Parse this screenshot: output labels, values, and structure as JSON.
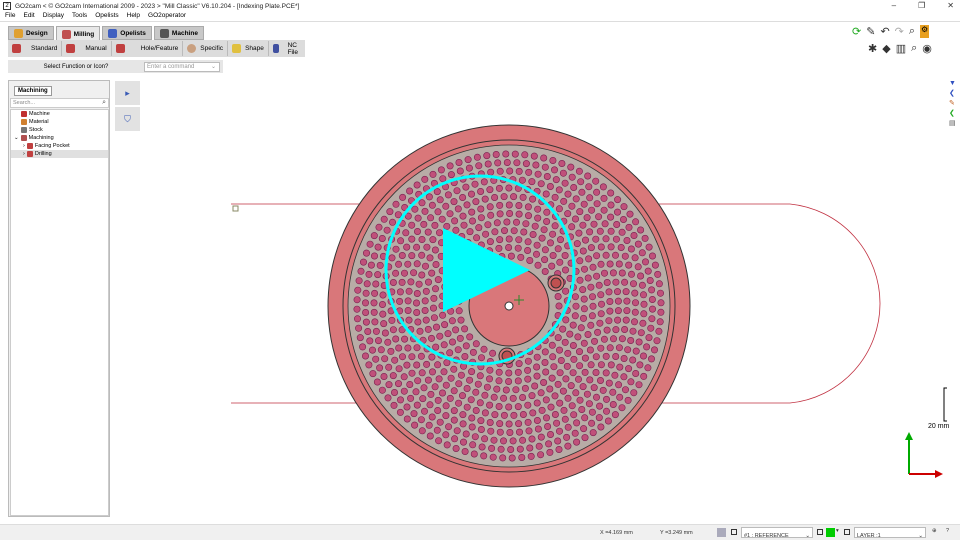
{
  "title": "GO2cam < © GO2cam International 2009 - 2023 >     \"Mill Classic\"   V6.10.204 - [Indexing Plate.PCE*]",
  "window_controls": [
    "–",
    "❐",
    "✕"
  ],
  "menu": [
    "File",
    "Edit",
    "Display",
    "Tools",
    "Opelists",
    "Help",
    "GO2operator"
  ],
  "tabs": [
    {
      "label": "Design",
      "color": "#e0a030"
    },
    {
      "label": "Milling",
      "color": "#c05050",
      "active": true
    },
    {
      "label": "Opelists",
      "color": "#4060c0"
    },
    {
      "label": "Machine",
      "color": "#555"
    }
  ],
  "toolbar": [
    {
      "label": "Standard"
    },
    {
      "label": "Manual"
    },
    {
      "label": "Hole/Feature"
    },
    {
      "label": "Specific"
    },
    {
      "label": "Shape"
    },
    {
      "label": "NC File"
    }
  ],
  "command": {
    "label": "Select Function or Icon?",
    "placeholder": "Enter a command"
  },
  "panel": {
    "tab": "Machining",
    "search_placeholder": "Search...",
    "tree": [
      {
        "label": "Machine",
        "level": 0,
        "color": "#c03030"
      },
      {
        "label": "Material",
        "level": 0,
        "color": "#d08030"
      },
      {
        "label": "Stock",
        "level": 0,
        "color": "#777"
      },
      {
        "label": "Machining",
        "level": 0,
        "expanded": true,
        "color": "#b05050"
      },
      {
        "label": "Facing Pocket",
        "level": 1,
        "color": "#c04040"
      },
      {
        "label": "Drilling",
        "level": 1,
        "color": "#c04040",
        "selected": true
      }
    ]
  },
  "scale": "20 mm",
  "status": {
    "x": "X =4.169 mm",
    "y": "Y =3.249 mm",
    "reference": "#1 : REFERENCE",
    "layer": "LAYER :1",
    "layer_color": "#00cc00"
  },
  "colors": {
    "ring": "#d9777a",
    "face": "#b8aca6",
    "hole": "#b84070",
    "cyan": "#00ffff",
    "contour": "#c03040"
  }
}
